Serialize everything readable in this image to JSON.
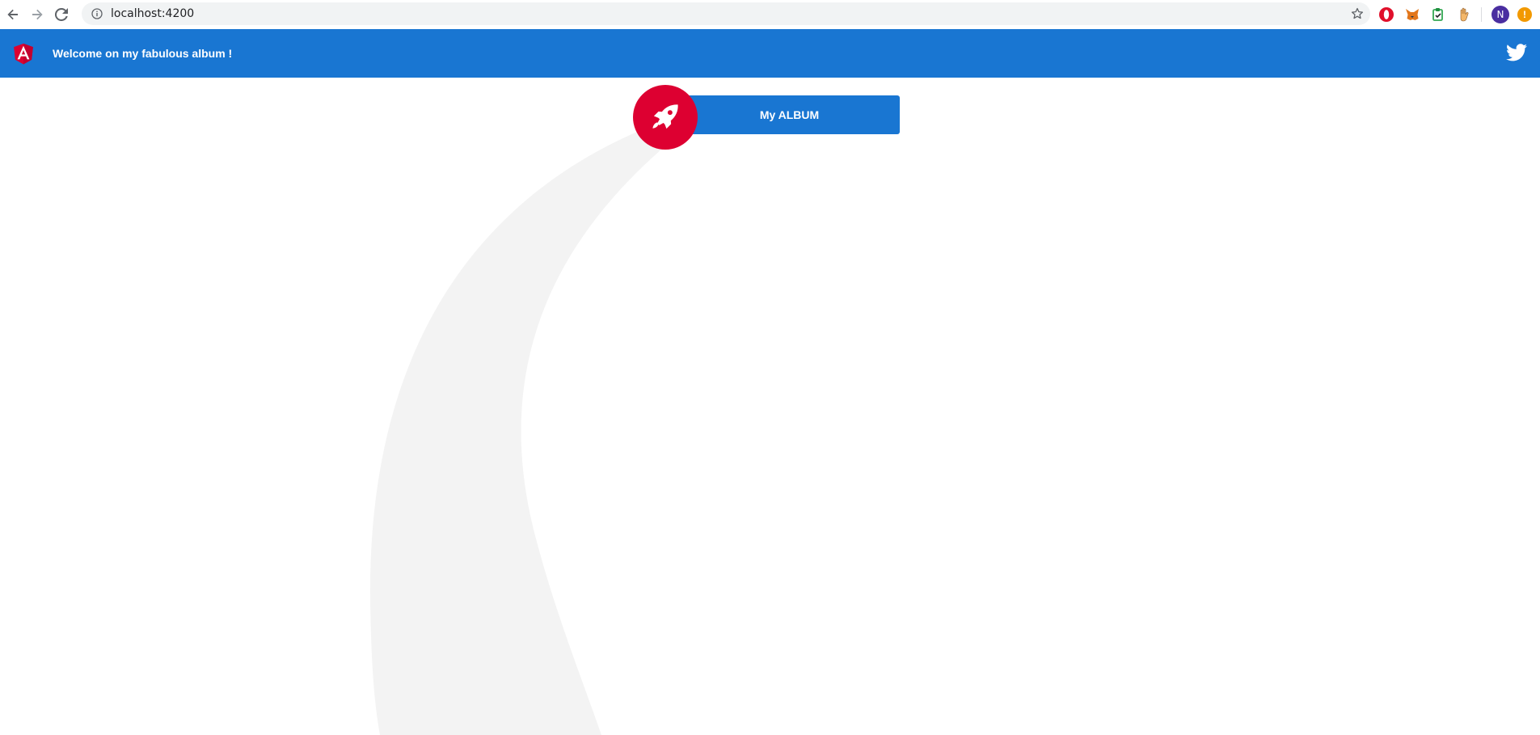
{
  "browser": {
    "url": "localhost:4200",
    "avatar_initial": "N",
    "warning_glyph": "!",
    "icons": [
      "back-arrow-icon",
      "forward-arrow-icon",
      "reload-icon",
      "info-icon",
      "bookmark-star-icon",
      "opera-extension-icon",
      "metamask-fox-icon",
      "clipboard-extension-icon",
      "hand-extension-icon",
      "profile-avatar",
      "update-warning-icon"
    ]
  },
  "toolbar": {
    "title": "Welcome on my fabulous album !",
    "background": "#1976d2",
    "logo_icon": "angular-logo-icon",
    "social_icon": "twitter-icon"
  },
  "main": {
    "album_button_label": "My ALBUM",
    "album_button_color": "#1976d2",
    "rocket_icon": "rocket-icon",
    "rocket_circle_color": "#dd0031",
    "trail_color": "#f3f3f3"
  }
}
